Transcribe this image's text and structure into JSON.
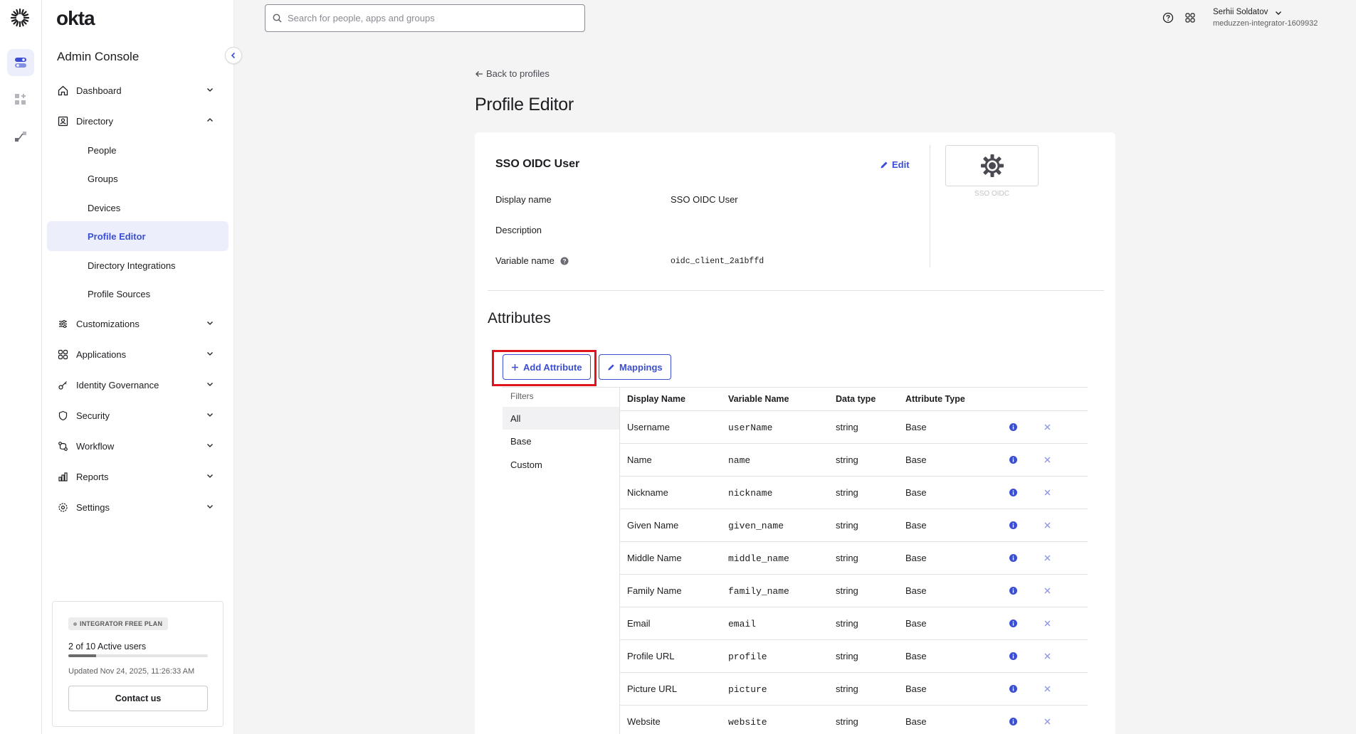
{
  "brand": "okta",
  "sidebar": {
    "console_title": "Admin Console",
    "nav": {
      "dashboard": "Dashboard",
      "directory": "Directory",
      "customizations": "Customizations",
      "applications": "Applications",
      "identity_governance": "Identity Governance",
      "security": "Security",
      "workflow": "Workflow",
      "reports": "Reports",
      "settings": "Settings"
    },
    "directory_items": {
      "people": "People",
      "groups": "Groups",
      "devices": "Devices",
      "profile_editor": "Profile Editor",
      "directory_integrations": "Directory Integrations",
      "profile_sources": "Profile Sources"
    },
    "plan": {
      "badge": "INTEGRATOR FREE PLAN",
      "users": "2 of 10 Active users",
      "progress_fraction": 0.2,
      "updated": "Updated Nov 24, 2025, 11:26:33 AM",
      "contact": "Contact us"
    }
  },
  "topbar": {
    "search_placeholder": "Search for people, apps and groups",
    "user_name": "Serhii Soldatov",
    "org": "meduzzen-integrator-1609932"
  },
  "main": {
    "back": "Back to profiles",
    "title": "Profile Editor",
    "profile": {
      "name": "SSO OIDC User",
      "edit": "Edit",
      "display_name_label": "Display name",
      "display_name_value": "SSO OIDC User",
      "description_label": "Description",
      "description_value": "",
      "variable_name_label": "Variable name",
      "variable_name_value": "oidc_client_2a1bffd",
      "app_caption": "SSO OIDC"
    },
    "attributes": {
      "title": "Attributes",
      "add_button": "Add Attribute",
      "mappings_button": "Mappings",
      "filters_label": "Filters",
      "filters": {
        "all": "All",
        "base": "Base",
        "custom": "Custom"
      },
      "columns": {
        "display_name": "Display Name",
        "variable_name": "Variable Name",
        "data_type": "Data type",
        "attribute_type": "Attribute Type"
      },
      "rows": [
        {
          "display": "Username",
          "variable": "userName",
          "type": "string",
          "attr": "Base"
        },
        {
          "display": "Name",
          "variable": "name",
          "type": "string",
          "attr": "Base"
        },
        {
          "display": "Nickname",
          "variable": "nickname",
          "type": "string",
          "attr": "Base"
        },
        {
          "display": "Given Name",
          "variable": "given_name",
          "type": "string",
          "attr": "Base"
        },
        {
          "display": "Middle Name",
          "variable": "middle_name",
          "type": "string",
          "attr": "Base"
        },
        {
          "display": "Family Name",
          "variable": "family_name",
          "type": "string",
          "attr": "Base"
        },
        {
          "display": "Email",
          "variable": "email",
          "type": "string",
          "attr": "Base"
        },
        {
          "display": "Profile URL",
          "variable": "profile",
          "type": "string",
          "attr": "Base"
        },
        {
          "display": "Picture URL",
          "variable": "picture",
          "type": "string",
          "attr": "Base"
        },
        {
          "display": "Website",
          "variable": "website",
          "type": "string",
          "attr": "Base"
        }
      ]
    }
  },
  "colors": {
    "accent": "#3a4fd3",
    "highlight": "#e0141f",
    "active_bg": "#eceffb"
  }
}
